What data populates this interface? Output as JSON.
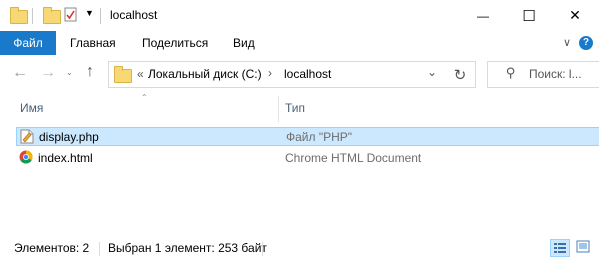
{
  "window": {
    "title": "localhost",
    "minimize_glyph": "—",
    "maximize_glyph": "☐",
    "close_glyph": "✕"
  },
  "ribbon": {
    "tabs": [
      "Файл",
      "Главная",
      "Поделиться",
      "Вид"
    ],
    "accent": "#1979ca",
    "expand_glyph": "∨",
    "help_glyph": "?"
  },
  "address": {
    "overflow_glyph": "«",
    "crumbs": [
      "Локальный диск (C:)",
      "localhost"
    ],
    "separator_glyph": "›"
  },
  "search": {
    "placeholder": "Поиск: l..."
  },
  "columns": {
    "name": "Имя",
    "type": "Тип"
  },
  "files": [
    {
      "name": "display.php",
      "type": "Файл \"PHP\"",
      "icon": "php-file-icon",
      "selected": true
    },
    {
      "name": "index.html",
      "type": "Chrome HTML Document",
      "icon": "chrome-html-icon",
      "selected": false
    }
  ],
  "status": {
    "items_count": "Элементов: 2",
    "selection": "Выбран 1 элемент: 253 байт"
  },
  "colors": {
    "selection_bg": "#cce8ff",
    "selection_border": "#99d1ff",
    "header_text": "#4c607a"
  }
}
